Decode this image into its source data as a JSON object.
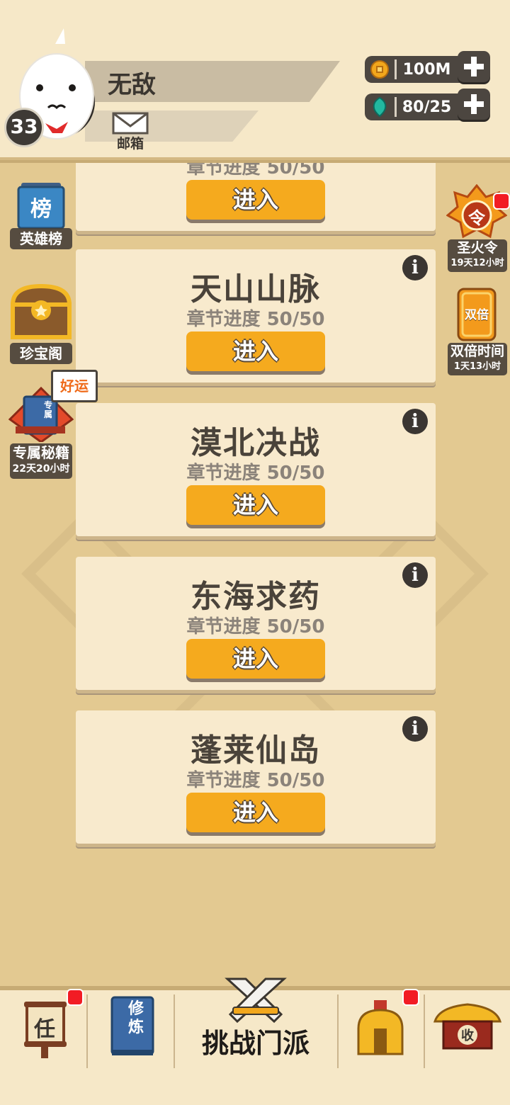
{
  "player": {
    "name": "无敌",
    "level": "33",
    "mail_label": "邮箱"
  },
  "resources": [
    {
      "icon": "coin-icon",
      "value": "100M",
      "color": "#f5a623"
    },
    {
      "icon": "gem-icon",
      "value": "80/25",
      "color": "#1fb7a0"
    }
  ],
  "chapters": [
    {
      "title": "",
      "progress": "章节进度 50/50",
      "button": "进入"
    },
    {
      "title": "天山山脉",
      "progress": "章节进度 50/50",
      "button": "进入"
    },
    {
      "title": "漠北决战",
      "progress": "章节进度 50/50",
      "button": "进入"
    },
    {
      "title": "东海求药",
      "progress": "章节进度 50/50",
      "button": "进入"
    },
    {
      "title": "蓬莱仙岛",
      "progress": "章节进度 50/50",
      "button": "进入"
    }
  ],
  "info_glyph": "i",
  "left_side": {
    "ranking": {
      "label": "英雄榜",
      "icon_char": "榜"
    },
    "treasure": {
      "label": "珍宝阁"
    },
    "secret_book": {
      "label": "专属秘籍",
      "timer": "22天20小时",
      "tag": "好运",
      "book_char": "专属"
    }
  },
  "right_side": {
    "holy_fire": {
      "label": "圣火令",
      "timer": "19天12小时",
      "icon_char": "令"
    },
    "double": {
      "label": "双倍时间",
      "timer": "1天13小时",
      "icon_char": "双倍"
    }
  },
  "bottom_nav": {
    "task_char": "任",
    "cultivate_chars": "修炼",
    "challenge_label": "挑战门派",
    "collect_char": "收"
  },
  "colors": {
    "accent_orange": "#f5aa1e",
    "background": "#e3c991",
    "card": "#f8eacd",
    "badge_red": "#f21c24"
  }
}
